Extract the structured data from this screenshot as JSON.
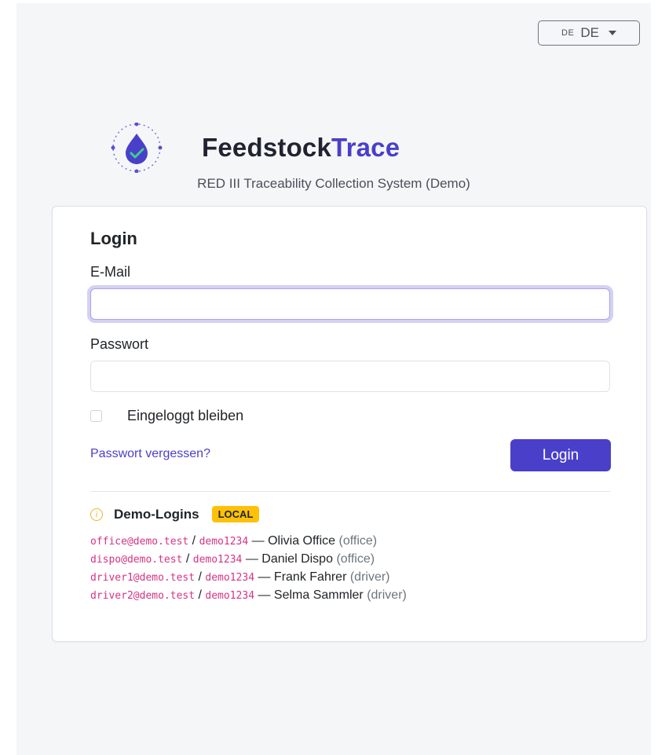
{
  "language": {
    "flag_code": "DE",
    "label": "DE"
  },
  "brand": {
    "name_main": "Feedstock",
    "name_accent": "Trace",
    "tagline": "RED III Traceability Collection System (Demo)"
  },
  "login_form": {
    "title": "Login",
    "email_label": "E-Mail",
    "email_value": "",
    "password_label": "Passwort",
    "password_value": "",
    "remember_label": "Eingeloggt bleiben",
    "forgot_link": "Passwort vergessen?",
    "submit_label": "Login"
  },
  "demo": {
    "title": "Demo-Logins",
    "badge": "LOCAL",
    "accounts": [
      {
        "email": "office@demo.test",
        "password": "demo1234",
        "name": "Olivia Office",
        "role": "(office)"
      },
      {
        "email": "dispo@demo.test",
        "password": "demo1234",
        "name": "Daniel Dispo",
        "role": "(office)"
      },
      {
        "email": "driver1@demo.test",
        "password": "demo1234",
        "name": "Frank Fahrer",
        "role": "(driver)"
      },
      {
        "email": "driver2@demo.test",
        "password": "demo1234",
        "name": "Selma Sammler",
        "role": "(driver)"
      }
    ]
  },
  "colors": {
    "accent": "#4a3fc9",
    "badge": "#ffc107",
    "code": "#d63384",
    "background": "#f5f6f8"
  },
  "icons": {
    "logo": "drop-check-logo-icon",
    "info": "info-icon",
    "caret": "caret-down-icon"
  }
}
